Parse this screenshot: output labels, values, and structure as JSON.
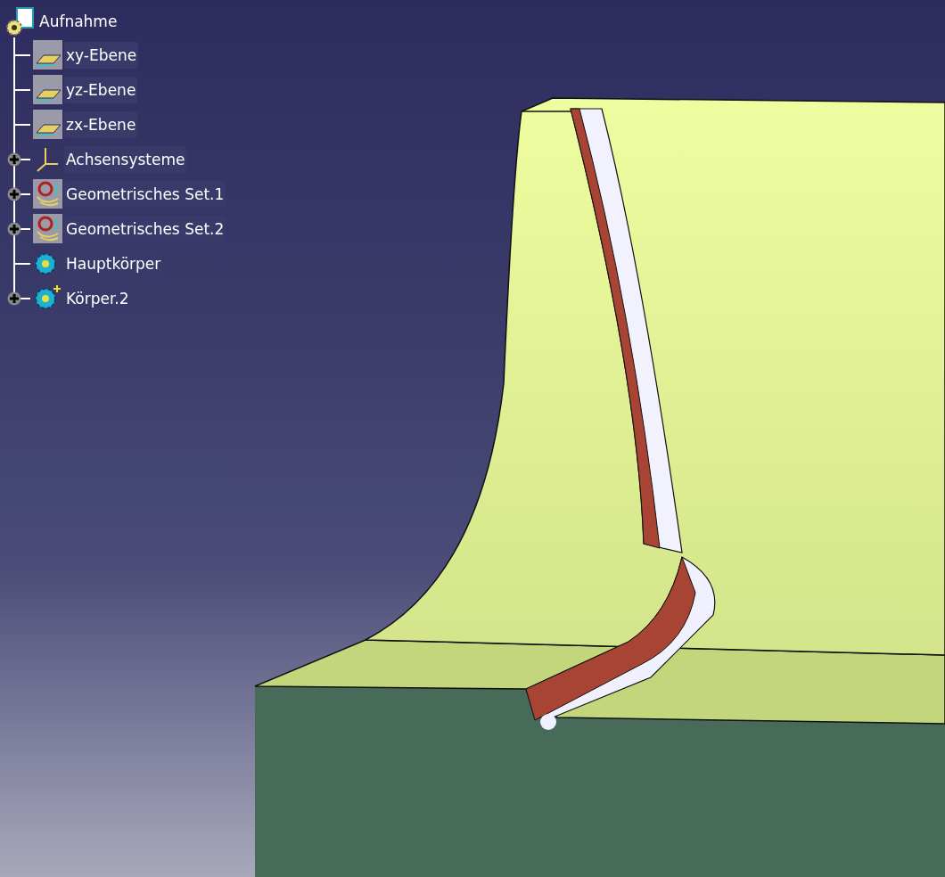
{
  "tree": {
    "root": {
      "label": "Aufnahme"
    },
    "children": [
      {
        "label": "xy-Ebene",
        "kind": "plane",
        "expandable": false
      },
      {
        "label": "yz-Ebene",
        "kind": "plane",
        "expandable": false
      },
      {
        "label": "zx-Ebene",
        "kind": "plane",
        "expandable": false
      },
      {
        "label": "Achsensysteme",
        "kind": "axes",
        "expandable": true
      },
      {
        "label": "Geometrisches Set.1",
        "kind": "geoset",
        "expandable": true
      },
      {
        "label": "Geometrisches Set.2",
        "kind": "geoset",
        "expandable": true
      },
      {
        "label": "Hauptkörper",
        "kind": "body",
        "expandable": false
      },
      {
        "label": "Körper.2",
        "kind": "newbody",
        "expandable": true
      }
    ]
  }
}
